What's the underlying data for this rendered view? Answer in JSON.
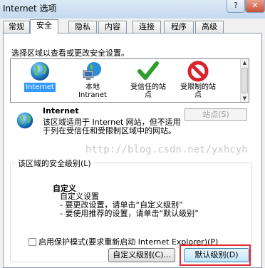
{
  "window": {
    "title": "Internet 选项",
    "help_label": "?",
    "close_label": "✕"
  },
  "tabs": [
    {
      "label": "常规"
    },
    {
      "label": "安全",
      "active": true
    },
    {
      "label": "隐私"
    },
    {
      "label": "内容"
    },
    {
      "label": "连接"
    },
    {
      "label": "程序"
    },
    {
      "label": "高级"
    }
  ],
  "zones": {
    "label": "选择区域以查看或更改安全设置。",
    "items": [
      {
        "label": "Internet",
        "icon": "globe-icon",
        "selected": true
      },
      {
        "label": "本地\nIntranet",
        "icon": "intranet-icon"
      },
      {
        "label": "受信任的站\n点",
        "icon": "checkmark-icon"
      },
      {
        "label": "受限制的站\n点",
        "icon": "restricted-icon"
      }
    ]
  },
  "description": {
    "title": "Internet",
    "text": "该区域适用于 Internet 网站，但不适用于列在受信任和受限制区域中的网站。",
    "sites_button": "站点(S)"
  },
  "security_level": {
    "legend": "该区域的安全级别(L)",
    "title": "自定义",
    "lines": [
      "自定义设置",
      "- 要更改设置，请单击“自定义级别”",
      "- 要使用推荐的设置，请单击“默认级别”"
    ]
  },
  "protected_mode": {
    "label": "启用保护模式(要求重新启动 Internet Explorer)(P)",
    "checked": false
  },
  "buttons": {
    "custom_level": "自定义级别(C)...",
    "default_level": "默认级别(D)"
  },
  "watermark": "http://blog.csdn.net/yxhcyh",
  "colors": {
    "selection": "#3399ff",
    "highlight_box": "#e0282e"
  }
}
